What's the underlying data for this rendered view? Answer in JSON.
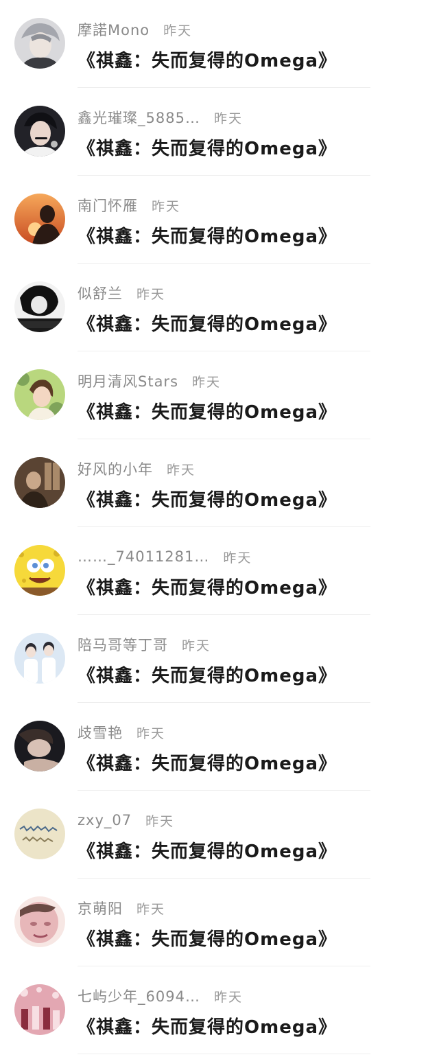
{
  "comments": [
    {
      "name": "摩諾Mono",
      "time": "昨天",
      "message": "《祺鑫：失而复得的Omega》",
      "avatar_icon": "avatar-silver-hair-boy-icon",
      "avatar_colors": [
        "#d9d9dc",
        "#8d8f96",
        "#3a3b40"
      ]
    },
    {
      "name": "鑫光璀璨_5885…",
      "time": "昨天",
      "message": "《祺鑫：失而复得的Omega》",
      "avatar_icon": "avatar-singer-with-mic-icon",
      "avatar_colors": [
        "#222228",
        "#e9d6cc",
        "#101014"
      ]
    },
    {
      "name": "南门怀雁",
      "time": "昨天",
      "message": "《祺鑫：失而复得的Omega》",
      "avatar_icon": "avatar-sunset-silhouette-icon",
      "avatar_colors": [
        "#f08a3a",
        "#c84b22",
        "#2a1a14"
      ]
    },
    {
      "name": "似舒兰",
      "time": "昨天",
      "message": "《祺鑫：失而复得的Omega》",
      "avatar_icon": "avatar-dark-sketch-icon",
      "avatar_colors": [
        "#f2f2f2",
        "#444444",
        "#111111"
      ]
    },
    {
      "name": "明月清风Stars",
      "time": "昨天",
      "message": "《祺鑫：失而复得的Omega》",
      "avatar_icon": "avatar-girl-in-garden-icon",
      "avatar_colors": [
        "#b9d77e",
        "#f3d7c2",
        "#7fa45a"
      ]
    },
    {
      "name": "好风的小年",
      "time": "昨天",
      "message": "《祺鑫：失而复得的Omega》",
      "avatar_icon": "avatar-dim-room-icon",
      "avatar_colors": [
        "#5a4433",
        "#a98a6a",
        "#2e2218"
      ]
    },
    {
      "name": "……_74011281…",
      "time": "昨天",
      "message": "《祺鑫：失而复得的Omega》",
      "avatar_icon": "avatar-spongebob-icon",
      "avatar_colors": [
        "#f6d93a",
        "#d8b324",
        "#5d8fd6"
      ]
    },
    {
      "name": "陪马哥等丁哥",
      "time": "昨天",
      "message": "《祺鑫：失而复得的Omega》",
      "avatar_icon": "avatar-two-boys-icon",
      "avatar_colors": [
        "#dce8f4",
        "#ffffff",
        "#2b2b33"
      ]
    },
    {
      "name": "歧雪艳",
      "time": "昨天",
      "message": "《祺鑫：失而复得的Omega》",
      "avatar_icon": "avatar-lying-portrait-icon",
      "avatar_colors": [
        "#1a1a1f",
        "#d8c1b5",
        "#3a2e2a"
      ]
    },
    {
      "name": "zxy_07",
      "time": "昨天",
      "message": "《祺鑫：失而复得的Omega》",
      "avatar_icon": "avatar-handwriting-icon",
      "avatar_colors": [
        "#ece4c8",
        "#4c6a8a",
        "#8a7d5a"
      ]
    },
    {
      "name": "京萌阳",
      "time": "昨天",
      "message": "《祺鑫：失而复得的Omega》",
      "avatar_icon": "avatar-blurred-face-icon",
      "avatar_colors": [
        "#e7b7b9",
        "#b07078",
        "#f7e7e4"
      ]
    },
    {
      "name": "七屿少年_6094…",
      "time": "昨天",
      "message": "《祺鑫：失而复得的Omega》",
      "avatar_icon": "avatar-pink-stage-icon",
      "avatar_colors": [
        "#e3a7b2",
        "#8a2d3e",
        "#f7dfe3"
      ]
    }
  ]
}
